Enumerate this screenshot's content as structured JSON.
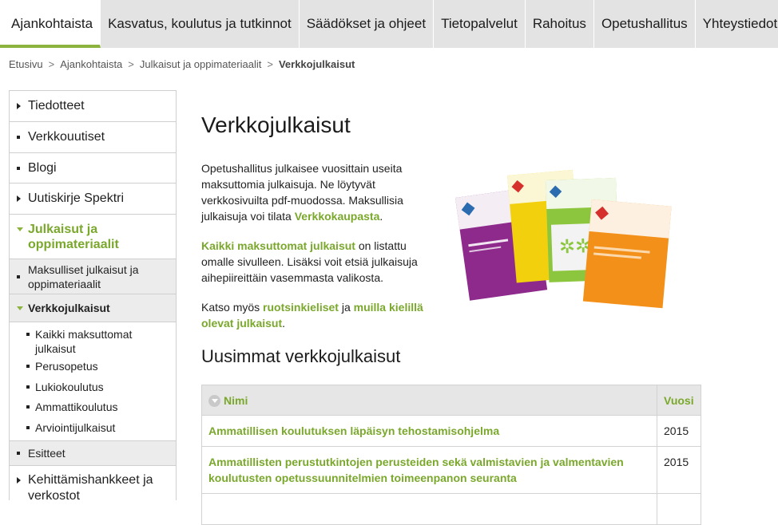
{
  "topnav": {
    "tabs": [
      {
        "label": "Ajankohtaista",
        "active": true
      },
      {
        "label": "Kasvatus, koulutus ja tutkinnot"
      },
      {
        "label": "Säädökset ja ohjeet"
      },
      {
        "label": "Tietopalvelut"
      },
      {
        "label": "Rahoitus"
      },
      {
        "label": "Opetushallitus"
      },
      {
        "label": "Yhteystiedot"
      }
    ]
  },
  "breadcrumb": {
    "items": [
      "Etusivu",
      "Ajankohtaista",
      "Julkaisut ja oppimateriaalit"
    ],
    "separator": ">",
    "current": "Verkkojulkaisut"
  },
  "sidebar": {
    "items": [
      {
        "label": "Tiedotteet",
        "icon": "triangle-right-icon"
      },
      {
        "label": "Verkkouutiset",
        "icon": "square-bullet-icon"
      },
      {
        "label": "Blogi",
        "icon": "square-bullet-icon"
      },
      {
        "label": "Uutiskirje Spektri",
        "icon": "triangle-right-icon"
      },
      {
        "label": "Julkaisut ja oppimateriaalit",
        "icon": "triangle-down-icon"
      }
    ],
    "sub": [
      {
        "label": "Maksulliset julkaisut ja oppimateriaalit"
      },
      {
        "label": "Verkkojulkaisut"
      }
    ],
    "sub3": [
      "Kaikki maksuttomat julkaisut",
      "Perusopetus",
      "Lukiokoulutus",
      "Ammattikoulutus",
      "Arviointijulkaisut"
    ],
    "after": [
      {
        "label": "Esitteet"
      },
      {
        "label": "Kehittämishankkeet ja verkostot"
      }
    ]
  },
  "main": {
    "title": "Verkkojulkaisut",
    "p1_text": "Opetushallitus julkaisee vuosittain useita maksuttomia julkaisuja. Ne löytyvät verkkosivuilta pdf-muodossa. Maksullisia julkaisuja voi tilata ",
    "p1_link": "Verkkokaupasta",
    "p1_end": ".",
    "p2_link": "Kaikki maksuttomat julkaisut",
    "p2_text": " on listattu omalle sivulleen. Lisäksi voit etsiä julkaisuja aihepiireittäin vasemmasta valikosta.",
    "p3_text": "Katso myös ",
    "p3_link1": "ruotsinkieliset",
    "p3_mid": " ja ",
    "p3_link2": "muilla kielillä olevat julkaisut",
    "p3_end": ".",
    "latest_heading": "Uusimmat verkkojulkaisut",
    "table": {
      "col_name": "Nimi",
      "col_year": "Vuosi",
      "rows": [
        {
          "name": "Ammatillisen koulutuksen läpäisyn tehostamisohjelma",
          "year": "2015"
        },
        {
          "name": "Ammatillisten perustutkintojen perusteiden sekä valmistavien ja valmentavien koulutusten opetussuunnitelmien toimeenpanon seuranta",
          "year": "2015"
        }
      ]
    }
  },
  "colors": {
    "accent_green": "#7aa82c",
    "nav_bg": "#e3e3e3",
    "book_purple": "#8e2a8c",
    "book_yellow": "#f2d00e",
    "book_green": "#8cc63f",
    "book_orange": "#f39019"
  }
}
